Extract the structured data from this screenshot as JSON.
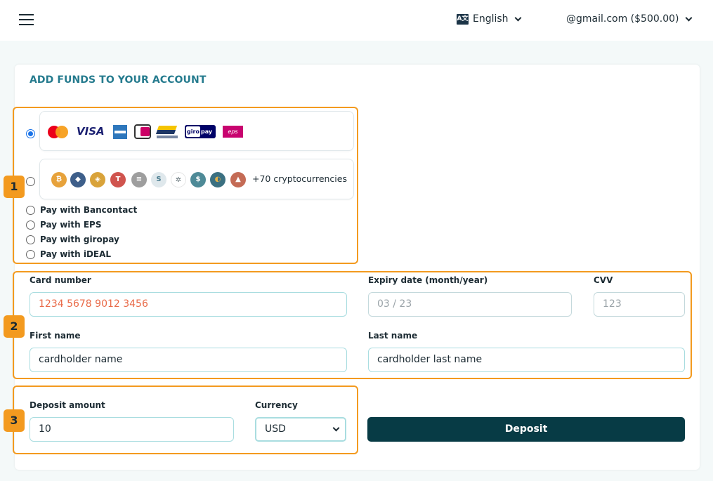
{
  "header": {
    "language": "English",
    "language_icon_text": "A文",
    "account": "@gmail.com ($500.00)"
  },
  "page": {
    "title": "ADD FUNDS TO YOUR ACCOUNT"
  },
  "callouts": [
    "1",
    "2",
    "3"
  ],
  "payment_methods": {
    "card_brands": [
      "Mastercard",
      "VISA",
      "American Express",
      "iDEAL",
      "Bancontact",
      "giropay",
      "eps"
    ],
    "crypto_label": "+70 cryptocurrencies",
    "options": [
      {
        "label": "Pay with Bancontact",
        "selected": false
      },
      {
        "label": "Pay with EPS",
        "selected": false
      },
      {
        "label": "Pay with giropay",
        "selected": false
      },
      {
        "label": "Pay with iDEAL",
        "selected": false
      }
    ]
  },
  "card_form": {
    "card_number_label": "Card number",
    "card_number_placeholder": "1234 5678 9012 3456",
    "expiry_label": "Expiry date (month/year)",
    "expiry_placeholder": "03 / 23",
    "cvv_label": "CVV",
    "cvv_placeholder": "123",
    "first_name_label": "First name",
    "first_name_value": "cardholder name",
    "last_name_label": "Last name",
    "last_name_value": "cardholder last name"
  },
  "deposit": {
    "amount_label": "Deposit amount",
    "amount_value": "10",
    "currency_label": "Currency",
    "currency_value": "USD",
    "button_label": "Deposit"
  },
  "colors": {
    "accent": "#257b8e",
    "highlight": "#f39a1f",
    "button": "#073b45",
    "placeholder_orange": "#e96a48"
  }
}
